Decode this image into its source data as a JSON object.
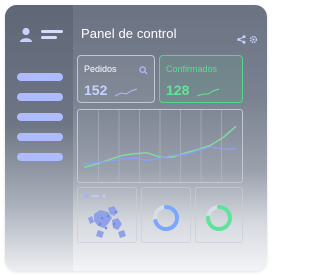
{
  "header": {
    "title": "Panel de control"
  },
  "cards": [
    {
      "label": "Pedidos",
      "value": "152"
    },
    {
      "label": "Confirmados",
      "value": "128"
    }
  ],
  "icons": {
    "user": "user-icon",
    "share": "share-icon",
    "settings": "gear-icon",
    "search": "search-icon"
  },
  "chart_data": {
    "type": "line",
    "title": "",
    "xlabel": "",
    "ylabel": "",
    "grid": true,
    "x": [
      0,
      1,
      2,
      3,
      4,
      5,
      6,
      7,
      8,
      9,
      10,
      11,
      12
    ],
    "series": [
      {
        "color": "#7ee0a0",
        "values": [
          10,
          14,
          19,
          24,
          26,
          27,
          22,
          22,
          27,
          31,
          36,
          45,
          58
        ]
      },
      {
        "color": "#8ea0f5",
        "values": [
          14,
          16,
          17,
          20,
          21,
          18,
          21,
          24,
          25,
          30,
          34,
          31,
          32
        ]
      }
    ],
    "ylim": [
      0,
      70
    ]
  },
  "bottom_cards": [
    {
      "label": "",
      "type": "map"
    },
    {
      "label": "",
      "type": "donut",
      "fraction": 0.7,
      "color": "#7aa7ff"
    },
    {
      "label": "",
      "type": "donut",
      "fraction": 0.75,
      "color": "#5fe39a"
    }
  ],
  "colors": {
    "accent_blue": "#aebcff",
    "accent_green": "#4fd98a"
  }
}
